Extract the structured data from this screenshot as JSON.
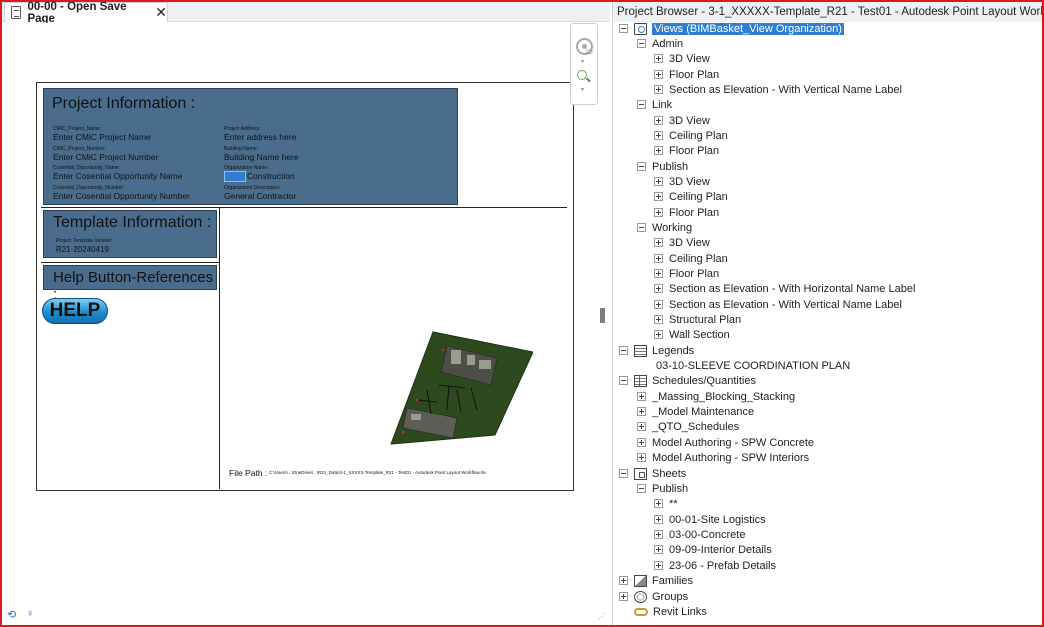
{
  "view_tab": {
    "title": "00-00 - Open Save Page",
    "close_glyph": "✕"
  },
  "sheet": {
    "project_information": {
      "title": "Project Information :",
      "fields_left": [
        {
          "label": "CMiC_Project_Name:",
          "value": "Enter CMiC Project Name"
        },
        {
          "label": "CMiC_Project_Number:",
          "value": "Enter CMiC Project Number"
        },
        {
          "label": "Cosential_Opportunity_Name:",
          "value": "Enter Cosential Opportunity Name"
        },
        {
          "label": "Cosential_Opportunity_Number:",
          "value": "Enter Cosential Opportunity Number"
        }
      ],
      "fields_right": [
        {
          "label": "Project Address:",
          "value": "Enter address here"
        },
        {
          "label": "Building Name:",
          "value": "Building Name here"
        },
        {
          "label": "Organization Name:",
          "value": "Construction"
        },
        {
          "label": "Organization Description:",
          "value": "General Contractor"
        }
      ]
    },
    "template_information": {
      "title": "Template Information :",
      "version_label": "Project Template Version:",
      "version_value": "R21-20240419"
    },
    "help_references": {
      "title": "Help Button-References :",
      "button_label": "HELP"
    },
    "file_path": {
      "label": "File Path :",
      "value": "C:\\Users\\...\\OneDrive\\...\\R21_Data\\3-1_XXXXX-Template_R21 - Test01 - Autodesk Point Layout Workflow.rte"
    }
  },
  "navbar": {
    "wheel_label": "2D"
  },
  "project_browser": {
    "header": "Project Browser - 3-1_XXXXX-Template_R21 - Test01 - Autodesk Point Layout Workflow.rte",
    "views_root": "Views (BIMBasket_View Organization)",
    "views_groups": [
      {
        "name": "Admin",
        "items": [
          "3D View",
          "Floor Plan",
          "Section as Elevation - With Vertical Name Label"
        ]
      },
      {
        "name": "Link",
        "items": [
          "3D View",
          "Ceiling Plan",
          "Floor Plan"
        ]
      },
      {
        "name": "Publish",
        "items": [
          "3D View",
          "Ceiling Plan",
          "Floor Plan"
        ]
      },
      {
        "name": "Working",
        "items": [
          "3D View",
          "Ceiling Plan",
          "Floor Plan",
          "Section as Elevation - With Horizontal Name Label",
          "Section as Elevation - With Vertical Name Label",
          "Structural Plan",
          "Wall Section"
        ]
      }
    ],
    "legends": {
      "name": "Legends",
      "items": [
        "03-10-SLEEVE COORDINATION PLAN"
      ]
    },
    "schedules": {
      "name": "Schedules/Quantities",
      "items": [
        "_Massing_Blocking_Stacking",
        "_Model Maintenance",
        "_QTO_Schedules",
        "Model Authoring - SPW Concrete",
        "Model Authoring - SPW Interiors"
      ]
    },
    "sheets": {
      "name": "Sheets",
      "group": "Publish",
      "items": [
        "**",
        "00-01-Site Logistics",
        "03-00-Concrete",
        "09-09-Interior Details",
        "23-06 - Prefab Details"
      ]
    },
    "families": "Families",
    "groups": "Groups",
    "revit_links": "Revit Links"
  }
}
